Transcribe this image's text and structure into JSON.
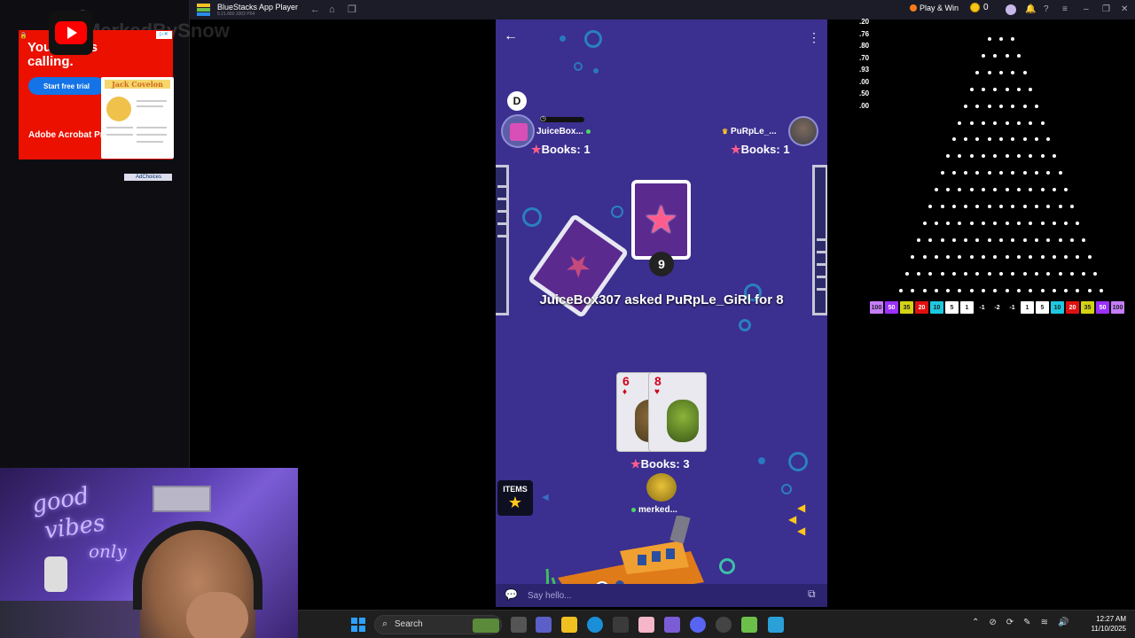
{
  "ad": {
    "header": "ement",
    "headline": "You    n job's calling.",
    "cta": "Start free trial",
    "brand": "Adobe Acrobat Pro",
    "doc_title": "Jack Covelon",
    "adchoices": "AdChoices",
    "channel_watermark": "MerkedBySnow"
  },
  "webcam": {
    "neon_line1": "good",
    "neon_line2": "vibes",
    "neon_line3": "only"
  },
  "bluestacks": {
    "title": "BlueStacks App Player",
    "version": "5.21.660.1002 P64",
    "play_win": "Play & Win",
    "coins": "0"
  },
  "game": {
    "dealer_badge": "D",
    "player1": {
      "name": "JuiceBox...",
      "books": "Books: 1"
    },
    "player2": {
      "name": "PuRpLe_...",
      "books": "Books: 1"
    },
    "card_count": "9",
    "message": "JuiceBox307 asked PuRpLe_GiRl for 8",
    "hand": [
      {
        "rank": "6",
        "suit": "♦"
      },
      {
        "rank": "8",
        "suit": "♥"
      }
    ],
    "my_books": "Books: 3",
    "my_name": "merked...",
    "items_label": "ITEMS",
    "chat_placeholder": "Say hello..."
  },
  "plinko": {
    "multipliers": [
      ".20",
      ".76",
      ".80",
      ".70",
      ".93",
      ".00",
      ".50",
      ".00"
    ],
    "buckets": [
      {
        "label": "100",
        "color": "#c77dff"
      },
      {
        "label": "50",
        "color": "#9b30ff"
      },
      {
        "label": "35",
        "color": "#d4d414"
      },
      {
        "label": "20",
        "color": "#e01010"
      },
      {
        "label": "10",
        "color": "#1ec8e0"
      },
      {
        "label": "5",
        "color": "#ffffff"
      },
      {
        "label": "1",
        "color": "#ffffff"
      },
      {
        "label": "-1",
        "color": "#000000"
      },
      {
        "label": "-2",
        "color": "#000000"
      },
      {
        "label": "-1",
        "color": "#000000"
      },
      {
        "label": "1",
        "color": "#ffffff"
      },
      {
        "label": "5",
        "color": "#ffffff"
      },
      {
        "label": "10",
        "color": "#1ec8e0"
      },
      {
        "label": "20",
        "color": "#e01010"
      },
      {
        "label": "35",
        "color": "#d4d414"
      },
      {
        "label": "50",
        "color": "#9b30ff"
      },
      {
        "label": "100",
        "color": "#c77dff"
      }
    ]
  },
  "taskbar": {
    "search_label": "Search",
    "time": "12:27 AM",
    "date": "11/10/2025"
  }
}
